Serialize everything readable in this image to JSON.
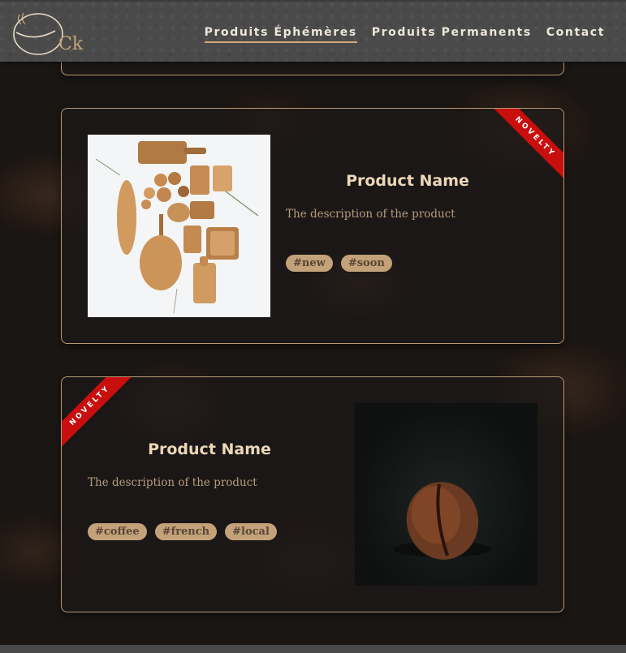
{
  "brand": {
    "logo_text": "Ck"
  },
  "nav": {
    "items": [
      {
        "label": "Produits Éphémères",
        "active": true
      },
      {
        "label": "Produits Permanents",
        "active": false
      },
      {
        "label": "Contact",
        "active": false
      }
    ]
  },
  "products": [
    {
      "ribbon": "NOVELTY",
      "name": "Product Name",
      "description": "The description of the product",
      "tags": [
        "#new",
        "#soon"
      ],
      "image_icon": "wooden-kitchenware-photo"
    },
    {
      "ribbon": "NOVELTY",
      "name": "Product Name",
      "description": "The description of the product",
      "tags": [
        "#coffee",
        "#french",
        "#local"
      ],
      "image_icon": "coffee-bean-photo"
    }
  ],
  "colors": {
    "accent": "#d1ad7a",
    "ribbon": "#c90e0e",
    "tag_bg": "#c3a27a",
    "header_bg": "#4a4a4a",
    "card_border": "#b89a72"
  }
}
